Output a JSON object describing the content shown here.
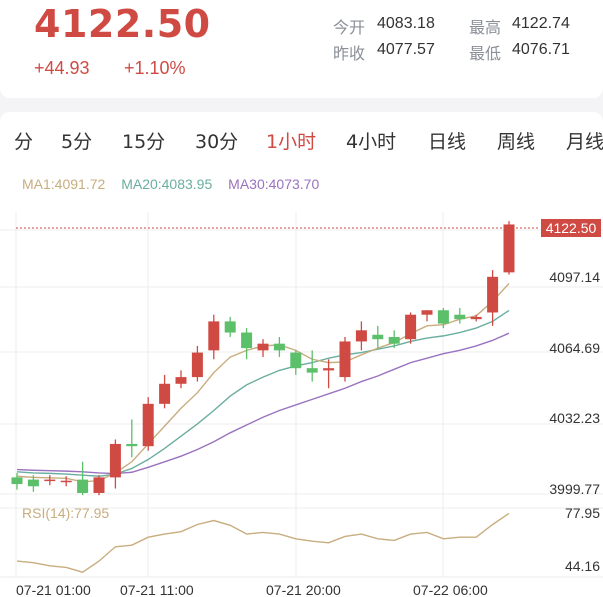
{
  "quote": {
    "price": "4122.50",
    "change": "+44.93",
    "change_pct": "+1.10%",
    "open_label": "今开",
    "open_value": "4083.18",
    "high_label": "最高",
    "high_value": "4122.74",
    "prev_close_label": "昨收",
    "prev_close_value": "4077.57",
    "low_label": "最低",
    "low_value": "4076.71"
  },
  "tabs": [
    {
      "label": "分",
      "active": false
    },
    {
      "label": "5分",
      "active": false
    },
    {
      "label": "15分",
      "active": false
    },
    {
      "label": "30分",
      "active": false
    },
    {
      "label": "1小时",
      "active": true
    },
    {
      "label": "4小时",
      "active": false
    },
    {
      "label": "日线",
      "active": false
    },
    {
      "label": "周线",
      "active": false
    },
    {
      "label": "月线",
      "active": false
    }
  ],
  "ma_legend": {
    "ma1": "MA1:4091.72",
    "ma20": "MA20:4083.95",
    "ma30": "MA30:4073.70"
  },
  "colors": {
    "up": "#d04a44",
    "down": "#5cbf6a",
    "ma1": "#c8ad7f",
    "ma20": "#6aaea0",
    "ma30": "#9a72c0",
    "rsi": "#c8ad7f"
  },
  "chart_data": {
    "type": "candlestick",
    "price_axis_ticks": [
      "4097.14",
      "4064.69",
      "4032.23",
      "3999.77"
    ],
    "last_price_label": "4122.50",
    "rsi_label": "RSI(14):77.95",
    "rsi_axis_ticks": [
      "77.95",
      "44.16"
    ],
    "time_labels": [
      "07-21 01:00",
      "07-21 11:00",
      "07-21 20:00",
      "07-22 06:00"
    ],
    "ylim": [
      3997.5,
      4124.5
    ],
    "rsi_ylim": [
      38.0,
      82.0
    ],
    "candles": [
      {
        "o": 4009.0,
        "h": 4011.0,
        "l": 4003.5,
        "c": 4006.0
      },
      {
        "o": 4008.0,
        "h": 4010.0,
        "l": 4002.5,
        "c": 4005.0
      },
      {
        "o": 4007.5,
        "h": 4010.0,
        "l": 4005.5,
        "c": 4008.0
      },
      {
        "o": 4007.5,
        "h": 4009.5,
        "l": 4005.0,
        "c": 4007.5
      },
      {
        "o": 4008.0,
        "h": 4016.0,
        "l": 4001.0,
        "c": 4002.0
      },
      {
        "o": 4002.0,
        "h": 4010.0,
        "l": 4001.0,
        "c": 4009.0
      },
      {
        "o": 4009.0,
        "h": 4026.0,
        "l": 4004.0,
        "c": 4024.0
      },
      {
        "o": 4024.0,
        "h": 4035.0,
        "l": 4018.0,
        "c": 4023.0
      },
      {
        "o": 4023.0,
        "h": 4045.0,
        "l": 4021.0,
        "c": 4042.0
      },
      {
        "o": 4042.0,
        "h": 4055.0,
        "l": 4040.0,
        "c": 4051.0
      },
      {
        "o": 4051.0,
        "h": 4057.0,
        "l": 4049.0,
        "c": 4054.0
      },
      {
        "o": 4054.0,
        "h": 4068.0,
        "l": 4052.0,
        "c": 4065.0
      },
      {
        "o": 4066.0,
        "h": 4082.0,
        "l": 4062.0,
        "c": 4079.0
      },
      {
        "o": 4079.0,
        "h": 4081.0,
        "l": 4072.0,
        "c": 4074.0
      },
      {
        "o": 4074.0,
        "h": 4076.0,
        "l": 4062.0,
        "c": 4067.0
      },
      {
        "o": 4066.0,
        "h": 4071.0,
        "l": 4063.0,
        "c": 4069.0
      },
      {
        "o": 4069.0,
        "h": 4072.0,
        "l": 4063.0,
        "c": 4066.0
      },
      {
        "o": 4065.0,
        "h": 4066.0,
        "l": 4055.0,
        "c": 4058.0
      },
      {
        "o": 4058.0,
        "h": 4066.0,
        "l": 4052.0,
        "c": 4056.0
      },
      {
        "o": 4057.0,
        "h": 4062.0,
        "l": 4049.0,
        "c": 4058.0
      },
      {
        "o": 4054.0,
        "h": 4072.0,
        "l": 4052.0,
        "c": 4070.0
      },
      {
        "o": 4070.0,
        "h": 4079.0,
        "l": 4066.0,
        "c": 4075.0
      },
      {
        "o": 4073.0,
        "h": 4077.0,
        "l": 4067.0,
        "c": 4071.0
      },
      {
        "o": 4072.0,
        "h": 4075.0,
        "l": 4067.0,
        "c": 4069.0
      },
      {
        "o": 4071.0,
        "h": 4083.0,
        "l": 4069.0,
        "c": 4082.0
      },
      {
        "o": 4082.0,
        "h": 4084.0,
        "l": 4079.0,
        "c": 4084.0
      },
      {
        "o": 4084.0,
        "h": 4085.0,
        "l": 4076.0,
        "c": 4078.0
      },
      {
        "o": 4082.0,
        "h": 4085.0,
        "l": 4078.0,
        "c": 4080.0
      },
      {
        "o": 4080.0,
        "h": 4082.0,
        "l": 4079.0,
        "c": 4081.0
      },
      {
        "o": 4083.0,
        "h": 4102.0,
        "l": 4077.0,
        "c": 4099.0
      },
      {
        "o": 4101.0,
        "h": 4124.0,
        "l": 4100.0,
        "c": 4122.5
      }
    ],
    "ma1": [
      4009.5,
      4009.0,
      4008.8,
      4008.6,
      4007.0,
      4007.5,
      4011.0,
      4016.0,
      4024.0,
      4032.0,
      4040.0,
      4047.0,
      4056.0,
      4063.0,
      4066.0,
      4068.0,
      4068.5,
      4066.0,
      4062.0,
      4060.5,
      4060.8,
      4064.0,
      4067.0,
      4069.5,
      4073.5,
      4077.0,
      4077.5,
      4080.0,
      4081.5,
      4088.0,
      4096.0
    ],
    "ma20": [
      4011.5,
      4011.0,
      4010.8,
      4010.5,
      4010.0,
      4009.5,
      4010.5,
      4013.0,
      4017.0,
      4022.0,
      4027.5,
      4033.0,
      4039.0,
      4045.5,
      4050.5,
      4054.0,
      4057.0,
      4059.0,
      4060.5,
      4062.5,
      4064.0,
      4065.0,
      4066.5,
      4068.0,
      4070.0,
      4071.5,
      4072.5,
      4074.0,
      4076.0,
      4079.0,
      4083.9
    ],
    "ma30": [
      4012.5,
      4012.2,
      4012.0,
      4011.8,
      4011.5,
      4011.0,
      4010.7,
      4011.3,
      4013.5,
      4016.0,
      4018.5,
      4021.5,
      4025.0,
      4029.0,
      4032.5,
      4036.0,
      4039.0,
      4041.5,
      4044.0,
      4046.5,
      4049.0,
      4052.0,
      4054.5,
      4057.5,
      4060.5,
      4062.5,
      4064.5,
      4066.0,
      4068.0,
      4070.5,
      4073.7
    ],
    "rsi": [
      48.0,
      47.0,
      45.0,
      44.0,
      41.0,
      48.0,
      57.0,
      58.0,
      63.0,
      65.0,
      66.5,
      71.0,
      73.5,
      70.5,
      65.0,
      66.0,
      65.0,
      62.0,
      60.5,
      59.5,
      63.5,
      65.0,
      62.0,
      61.0,
      65.0,
      66.0,
      62.0,
      63.0,
      63.0,
      71.0,
      77.95
    ]
  }
}
